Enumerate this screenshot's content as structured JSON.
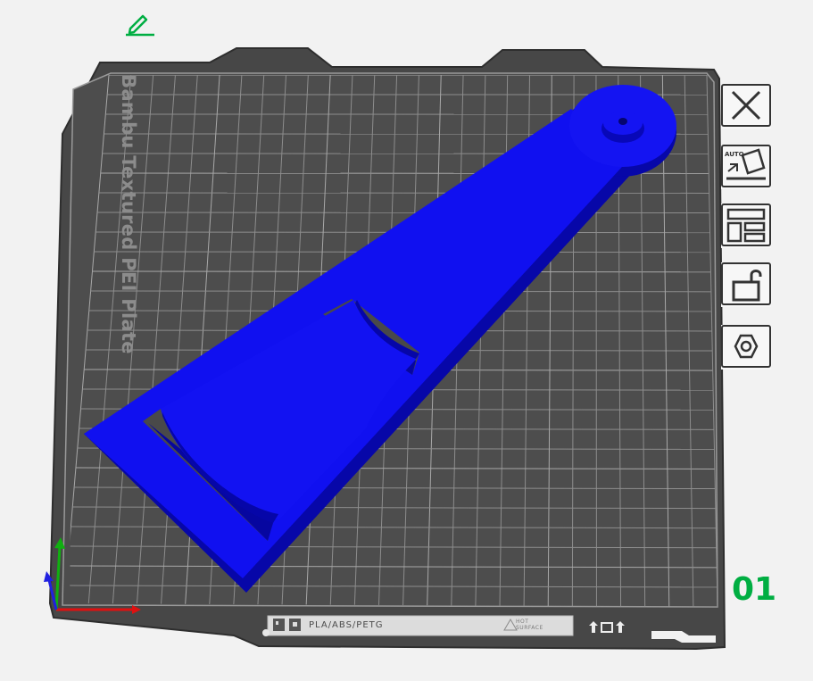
{
  "plate": {
    "name": "Bambu Textured PEI Plate",
    "number": "01",
    "filament_label": "PLA/ABS/PETG",
    "hot_surface_line1": "HOT",
    "hot_surface_line2": "SURFACE"
  },
  "toolbar": {
    "edit_icon": "pencil-underline-icon",
    "items": [
      {
        "name": "remove-plate",
        "icon": "close-icon"
      },
      {
        "name": "auto-orient",
        "icon": "auto-orient-icon",
        "badge": "AUTO"
      },
      {
        "name": "arrange",
        "icon": "arrange-icon"
      },
      {
        "name": "lock",
        "icon": "unlock-icon"
      },
      {
        "name": "plate-settings",
        "icon": "hex-nut-icon"
      }
    ]
  },
  "colors": {
    "model": "#0f0ff0",
    "plate": "#4b4b4b",
    "grid": "#8a8a8a",
    "accent": "#00ae42",
    "axis_x": "#e01010",
    "axis_y": "#10b010",
    "axis_z": "#2020e0"
  }
}
